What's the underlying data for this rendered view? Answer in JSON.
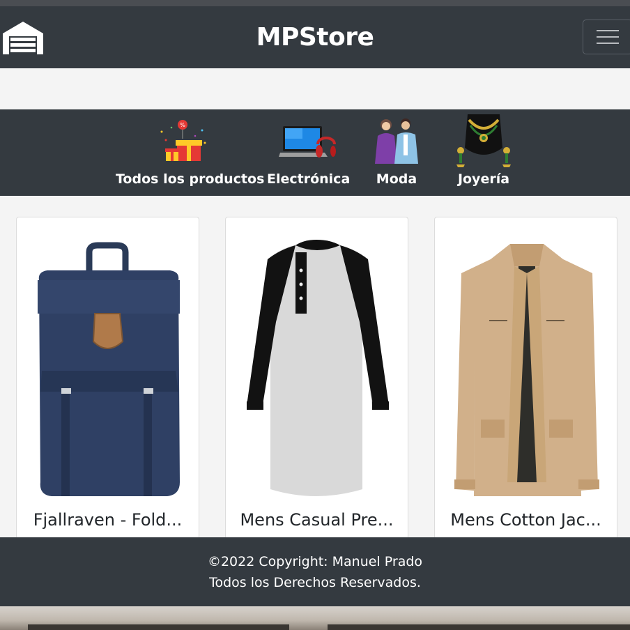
{
  "navbar": {
    "brand": "MPStore",
    "logo_icon": "warehouse-garage-icon",
    "menu_icon": "hamburger-menu-icon"
  },
  "categories": [
    {
      "label": "Todos los productos",
      "icon": "gift-boxes-icon"
    },
    {
      "label": "Electrónica",
      "icon": "laptop-headphones-icon"
    },
    {
      "label": "Moda",
      "icon": "fashion-couple-icon"
    },
    {
      "label": "Joyería",
      "icon": "necklace-jewelry-icon"
    }
  ],
  "products": [
    {
      "title": "Fjallraven - Fold...",
      "image": "navy-backpack"
    },
    {
      "title": "Mens Casual Pre...",
      "image": "raglan-henley-shirt"
    },
    {
      "title": "Mens Cotton Jac...",
      "image": "khaki-jacket"
    }
  ],
  "footer": {
    "copyright": "©2022 Copyright: Manuel Prado",
    "rights": "Todos los Derechos Reservados."
  },
  "colors": {
    "navbar_bg": "#343a40",
    "page_bg": "#f4f4f4",
    "text_light": "#ffffff"
  }
}
